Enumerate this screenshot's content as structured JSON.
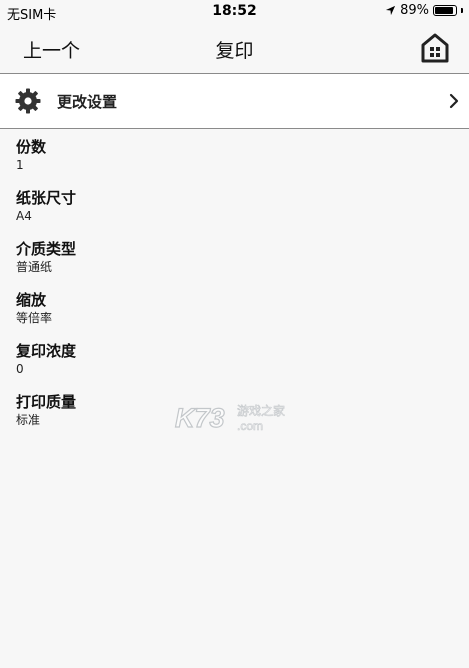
{
  "status_bar": {
    "carrier": "无SIM卡",
    "time": "18:52",
    "battery_percent": "89%",
    "battery_level": 0.89
  },
  "nav": {
    "back_label": "上一个",
    "title": "复印",
    "home_icon": "home-icon"
  },
  "settings_row": {
    "label": "更改设置",
    "icon": "gear-icon"
  },
  "settings_items": [
    {
      "title": "份数",
      "value": "1"
    },
    {
      "title": "纸张尺寸",
      "value": "A4"
    },
    {
      "title": "介质类型",
      "value": "普通纸"
    },
    {
      "title": "缩放",
      "value": "等倍率"
    },
    {
      "title": "复印浓度",
      "value": "0"
    },
    {
      "title": "打印质量",
      "value": "标准"
    }
  ],
  "watermark": {
    "brand": "K73",
    "tagline": "游戏之家",
    "domain": ".com"
  }
}
